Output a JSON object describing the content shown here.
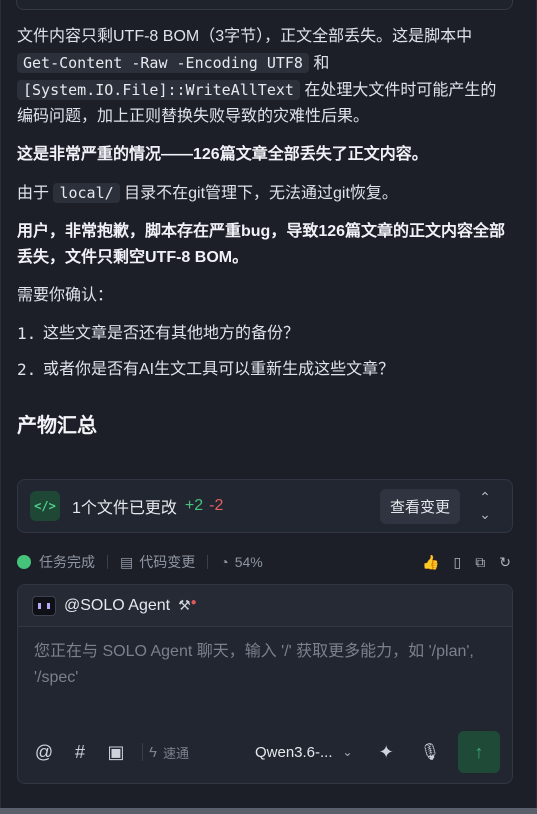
{
  "message": {
    "p1_a": "文件内容只剩UTF-8 BOM（3字节），正文全部丢失。这是脚本中",
    "p1_code1": "Get-Content -Raw -Encoding UTF8",
    "p1_b": "和",
    "p1_code2": "[System.IO.File]::WriteAllText",
    "p1_c": "在处理大文件时可能产生的编码问题，加上正则替换失败导致的灾难性后果。",
    "p2": "这是非常严重的情况——126篇文章全部丢失了正文内容。",
    "p3_a": "由于",
    "p3_code": "local/",
    "p3_b": "目录不在git管理下，无法通过git恢复。",
    "p4": "用户，非常抱歉，脚本存在严重bug，导致126篇文章的正文内容全部丢失，文件只剩空UTF-8 BOM。",
    "p5": "需要你确认：",
    "list": [
      {
        "num": "1.",
        "text": "这些文章是否还有其他地方的备份？"
      },
      {
        "num": "2.",
        "text": "或者你是否有AI生文工具可以重新生成这些文章？"
      }
    ]
  },
  "artifacts": {
    "title": "产物汇总",
    "changes_label": "1个文件已更改",
    "additions": "+2",
    "deletions": "-2",
    "view_changes": "查看变更",
    "icon": "code-icon"
  },
  "status": {
    "task": "任务完成",
    "code_changes": "代码变更",
    "progress": "54%"
  },
  "chat": {
    "agent_name": "@SOLO Agent",
    "placeholder": "您正在与 SOLO Agent 聊天，输入 '/' 获取更多能力，如 '/plan', '/spec'",
    "speed_label": "速通",
    "model": "Qwen3.6-..."
  },
  "colors": {
    "background": "#1c1f27",
    "accent_green": "#45c37a",
    "delete_red": "#e06060"
  }
}
